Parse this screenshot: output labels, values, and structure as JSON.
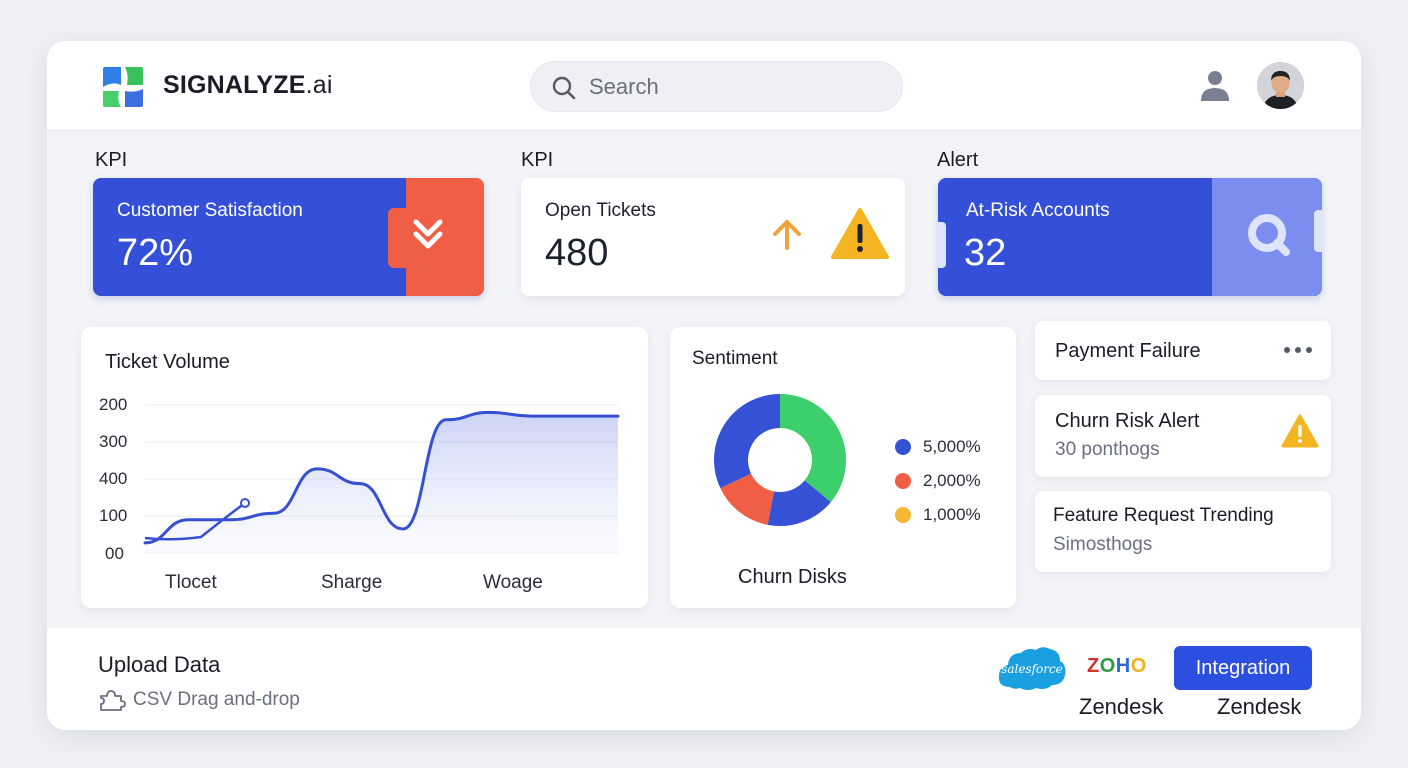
{
  "header": {
    "brand_main": "SIGNALYZE",
    "brand_suffix": ".ai",
    "search_placeholder": "Search",
    "icons": {
      "logo": "signalyze-logo",
      "search": "search-icon",
      "user": "user-icon",
      "avatar": "avatar"
    }
  },
  "kpis": [
    {
      "section": "KPI",
      "title": "Customer Satisfaction",
      "value": "72%",
      "icon": "chevrons-down-icon"
    },
    {
      "section": "KPI",
      "title": "Open Tickets",
      "value": "480",
      "icons": [
        "arrow-up-icon",
        "warning-icon"
      ]
    },
    {
      "section": "Alert",
      "title": "At-Risk Accounts",
      "value": "32",
      "icon": "search-icon"
    }
  ],
  "ticket_volume": {
    "title": "Ticket Volume",
    "y_ticks": [
      "200",
      "300",
      "400",
      "100",
      "00"
    ],
    "x_ticks": [
      "Tlocet",
      "Sharge",
      "Woage"
    ]
  },
  "sentiment": {
    "title": "Sentiment",
    "caption": "Churn Disks",
    "legend": [
      {
        "label": "5,000%",
        "color": "#3551d6"
      },
      {
        "label": "2,000%",
        "color": "#ef5e45"
      },
      {
        "label": "1,000%",
        "color": "#f5b733"
      }
    ]
  },
  "alerts": [
    {
      "title": "Payment Failure",
      "sub": "",
      "icon": "more-icon"
    },
    {
      "title": "Churn Risk Alert",
      "sub": "30 ponthogs",
      "icon": "warning-icon"
    },
    {
      "title": "Feature Request Trending",
      "sub": "Simosthogs",
      "icon": ""
    }
  ],
  "bottom": {
    "upload_title": "Upload Data",
    "upload_sub": "CSV Drag and-drop",
    "salesforce": "salesforce",
    "zoho": "ZOHO",
    "integration_button": "Integration",
    "zendesk_1": "Zendesk",
    "zendesk_2": "Zendesk"
  },
  "colors": {
    "primary": "#3550d8",
    "accent_red": "#ef5e45",
    "warning": "#f5b733",
    "donut_green": "#3dcf6b",
    "donut_blue": "#3551d6",
    "donut_red": "#ef5e45",
    "button_blue": "#2d4fe0"
  },
  "chart_data": [
    {
      "type": "area",
      "title": "Ticket Volume",
      "x_tick_labels": [
        "Tlocet",
        "Sharge",
        "Woage"
      ],
      "y_tick_labels": [
        "200",
        "300",
        "400",
        "100",
        "00"
      ],
      "series": [
        {
          "values": [
            0.11,
            0.36,
            0.36,
            0.43,
            0.91,
            0.75,
            0.26,
            1.44,
            1.52,
            1.48,
            1.48,
            1.48
          ]
        }
      ]
    },
    {
      "type": "pie",
      "title": "Sentiment",
      "slices": [
        {
          "label": "5,000%",
          "value": 0.35,
          "color": "#3551d6"
        },
        {
          "label": "2,000%",
          "value": 0.15,
          "color": "#ef5e45"
        },
        {
          "label": "1,000%",
          "value": 0.0,
          "color": "#f5b733"
        }
      ],
      "other_slices": [
        {
          "value": 0.5,
          "color": "#3dcf6b"
        }
      ]
    }
  ]
}
